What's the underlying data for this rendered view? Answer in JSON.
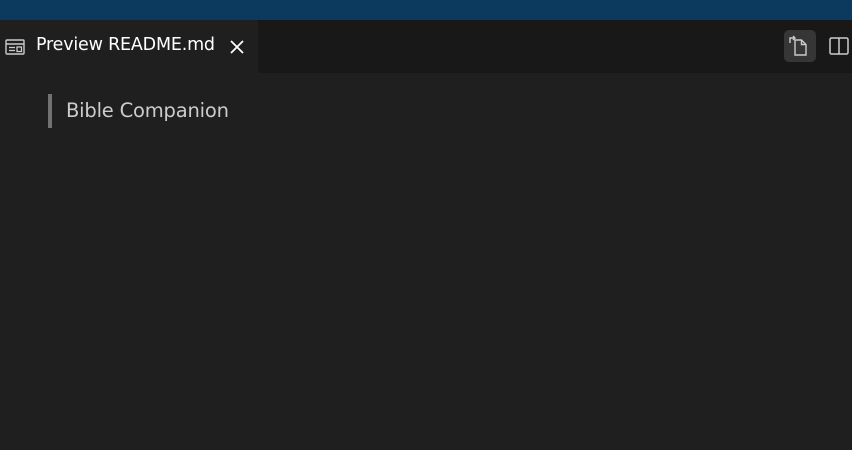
{
  "titlebar": {
    "color": "#0c3a5e"
  },
  "tab": {
    "icon": "preview-icon",
    "label": "Preview README.md",
    "close_icon": "close-icon"
  },
  "editor_actions": [
    {
      "icon": "open-source-icon",
      "active": true
    },
    {
      "icon": "split-editor-icon",
      "active": false
    }
  ],
  "preview": {
    "blockquote_text": "Bible Companion"
  },
  "colors": {
    "editor_background": "#1f1f1f",
    "tabbar_background": "#181818",
    "blockquote_border": "#727272",
    "text": "#cccccc"
  }
}
